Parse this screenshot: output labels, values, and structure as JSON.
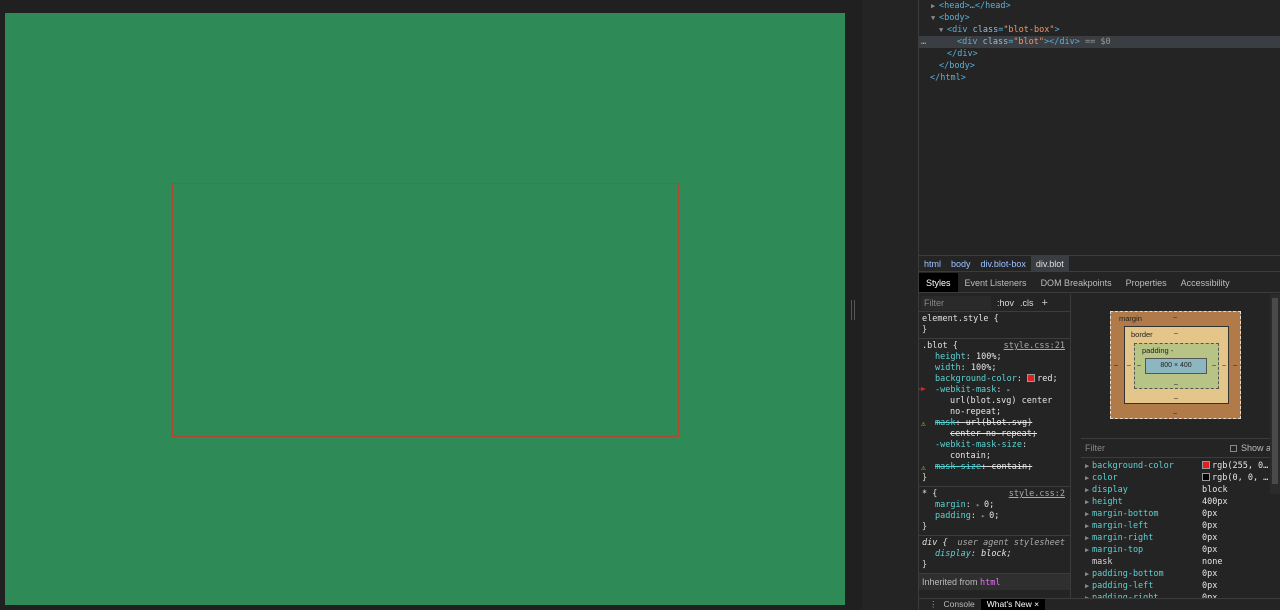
{
  "dom": {
    "lines": [
      {
        "indent": 12,
        "tri": "▶",
        "open": "<head>",
        "rest": "…</head>"
      },
      {
        "indent": 12,
        "tri": "▼",
        "open": "<body>",
        "rest": ""
      },
      {
        "indent": 20,
        "tri": "▼",
        "open": "<div ",
        "attr": "class",
        "val": "\"blot-box\"",
        "close": ">"
      },
      {
        "indent": 38,
        "tri": "",
        "open": "<div ",
        "attr": "class",
        "val": "\"blot\"",
        "close": "></div>",
        "eq": " == $0",
        "selected": true
      },
      {
        "indent": 28,
        "tri": "",
        "open": "</div>",
        "rest": ""
      },
      {
        "indent": 20,
        "tri": "",
        "open": "</body>",
        "rest": ""
      },
      {
        "indent": 11,
        "tri": "",
        "open": "</html>",
        "rest": ""
      }
    ],
    "ellipsis": "…"
  },
  "breadcrumbs": [
    "html",
    "body",
    "div.blot-box",
    "div.blot"
  ],
  "panel_tabs": [
    "Styles",
    "Event Listeners",
    "DOM Breakpoints",
    "Properties",
    "Accessibility"
  ],
  "styles": {
    "filter_placeholder": "Filter",
    "hov": ":hov",
    "cls": ".cls",
    "plus": "+",
    "element_style": "element.style {",
    "close_brace": "}",
    "blot_selector": ".blot {",
    "blot_source": "style.css:21",
    "blot_props": [
      {
        "name": "height",
        "value": "100%;"
      },
      {
        "name": "width",
        "value": "100%;"
      },
      {
        "name": "background-color",
        "value": "red;"
      },
      {
        "name": "-webkit-mask",
        "value": ""
      },
      {
        "name": "",
        "value": "url(blot.svg) center"
      },
      {
        "name": "",
        "value": "no-repeat;"
      },
      {
        "name": "mask",
        "value": "url(blot.svg)"
      },
      {
        "name": "",
        "value": "center no-repeat;"
      },
      {
        "name": "-webkit-mask-size",
        "value": ""
      },
      {
        "name": "",
        "value": "contain;"
      },
      {
        "name": "mask-size",
        "value": "contain;"
      }
    ],
    "star_selector": "* {",
    "star_source": "style.css:2",
    "star_props": [
      {
        "name": "margin",
        "value": "0;"
      },
      {
        "name": "padding",
        "value": "0;"
      }
    ],
    "div_selector": "div {",
    "div_source": "user agent stylesheet",
    "div_props": [
      {
        "name": "display",
        "value": "block;"
      }
    ],
    "inherited_label": "Inherited from",
    "inherited_tag": "html"
  },
  "box_model": {
    "margin_label": "margin",
    "border_label": "border",
    "padding_label": "padding -",
    "content": "800 × 400",
    "dash": "–"
  },
  "computed": {
    "filter_placeholder": "Filter",
    "show_all": "Show all",
    "props": [
      {
        "name": "background-color",
        "value": "rgb(255, 0…",
        "swatch": "red"
      },
      {
        "name": "color",
        "value": "rgb(0, 0, …",
        "swatch": "black"
      },
      {
        "name": "display",
        "value": "block"
      },
      {
        "name": "height",
        "value": "400px"
      },
      {
        "name": "margin-bottom",
        "value": "0px"
      },
      {
        "name": "margin-left",
        "value": "0px"
      },
      {
        "name": "margin-right",
        "value": "0px"
      },
      {
        "name": "margin-top",
        "value": "0px"
      },
      {
        "name": "mask",
        "value": "none",
        "noTri": true
      },
      {
        "name": "padding-bottom",
        "value": "0px"
      },
      {
        "name": "padding-left",
        "value": "0px"
      },
      {
        "name": "padding-right",
        "value": "0px"
      }
    ]
  },
  "drawer": {
    "menu": "⋮",
    "tabs": [
      "Console",
      "What's New"
    ],
    "close": "×"
  },
  "colors": {
    "page_bg": "#2e8b57",
    "blot_outline": "#b0482f",
    "devtools_bg": "#242424"
  }
}
